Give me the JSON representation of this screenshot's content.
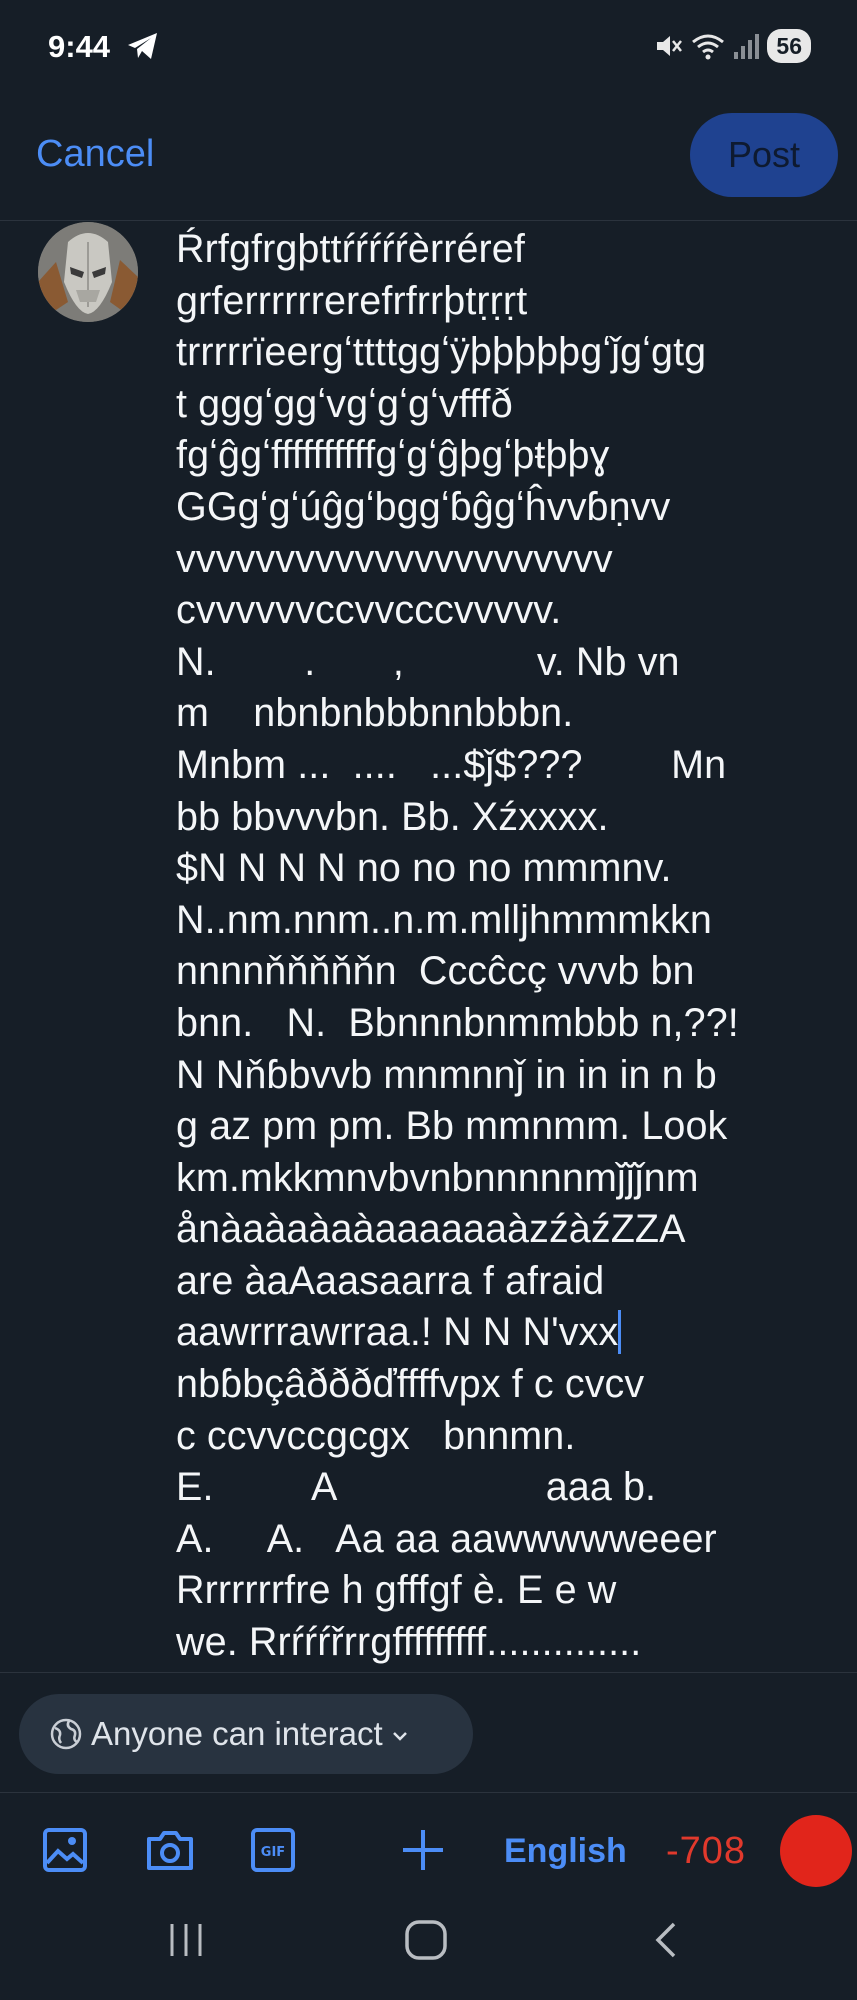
{
  "status_bar": {
    "time": "9:44",
    "battery": "56",
    "icons": [
      "telegram-icon",
      "mute-icon",
      "wifi-icon",
      "signal-icon",
      "battery-indicator"
    ]
  },
  "header": {
    "cancel_label": "Cancel",
    "post_label": "Post"
  },
  "composer": {
    "avatar": "user-avatar",
    "text_before_cursor": "Ŕrfgfrgþttŕŕŕŕŕèrréref\ngrferrrrrrerefrfrrþtṛṛṛt\ntrrrrrïeergʻttttggʻÿþþþþþgʻǰgʻgtg\nt gggʻggʻvgʻgʻgʻvfffð\nfgʻĝgʻffffffffffgʻgʻĝþgʻþŧþþɣ\nGGgʻgʻúĝgʻbggʻɓĝgʻĥvvɓṇvv\nvvvvvvvvvvvvvvvvvvvvvv\ncvvvvvvccvvcccvvvvv.\nN.        .       ,            v. Nb vn\nm    nbnbnbbbnnbbbn.\nMnbm ...  ....   ...$ǰ$???        Mn\nbb bbvvvbn. Bb. Xźxxxx.\n$N N N N no no no mmmnv.\nN..nm.nnm..n.m.mlljhmmmkkn\nnnnnňňňňňn  Cccĉcç vvvb bn\nbnn.   N.  Bbnnnbnmmbbb n,??!\nN Nňɓbvvb mnmnnǰ in in in n b\ng az pm pm. Bb mmnmm. Look\nkm.mkkmnvbvnbnnnnnmǰǰǰnm\nånàaàaàaàaaaaaaàzźàźZZA\nare àaAaasaarra f afraid\naawrrrawrraa.! N N N'vxx",
    "text_after_cursor": "\nnbɓbçâðððďffffvpx f c cvcv\nc ccvvccgcgx   bnnmn.\nE.         A                   aaa b.\nA.     A.   Aa aa aawwwwweeer\nRrrrrrrfre h gfffgf è. E e w\nwe. Rrŕŕŕřrrgfffffffff.............."
  },
  "reply_settings": {
    "label": "Anyone can interact",
    "icon": "globe-icon"
  },
  "toolbar": {
    "icons": [
      "image-icon",
      "camera-icon",
      "gif-icon",
      "plus-icon"
    ],
    "language": "English",
    "char_counter": "-708",
    "record_icon": "record-circle-icon"
  },
  "nav_bar": {
    "icons": [
      "recents-icon",
      "home-icon",
      "back-icon"
    ]
  },
  "colors": {
    "background": "#161e27",
    "accent": "#4c8df6",
    "post_button": "#1f4290",
    "counter_negative": "#e1392c"
  }
}
